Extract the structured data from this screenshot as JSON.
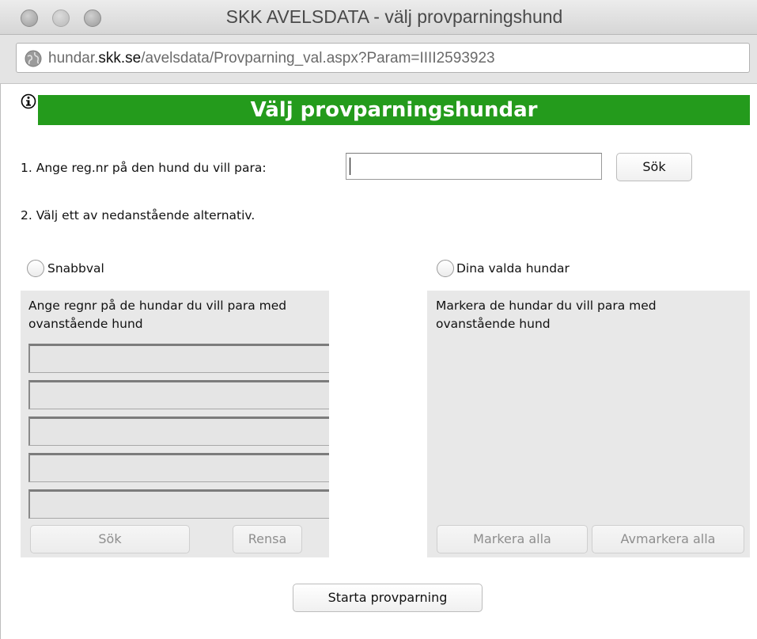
{
  "window": {
    "title": "SKK AVELSDATA - välj provparningshund"
  },
  "address": {
    "url_prefix": "hundar.",
    "url_domain": "skk.se",
    "url_path": "/avelsdata/Provparning_val.aspx?Param=IIII2593923"
  },
  "page": {
    "info_icon": "info-icon",
    "header": "Välj provparningshundar",
    "step1_label": "1. Ange reg.nr på den hund du vill para:",
    "reg_input_value": "",
    "search_button": "Sök",
    "step2_label": "2. Välj ett av nedanstående alternativ."
  },
  "quick": {
    "radio_label": "Snabbval",
    "selected": false,
    "instruction": "Ange regnr på de hundar du vill para med ovanstående hund",
    "inputs": [
      "",
      "",
      "",
      "",
      ""
    ],
    "search_button": "Sök",
    "clear_button": "Rensa"
  },
  "chosen": {
    "radio_label": "Dina valda hundar",
    "selected": false,
    "instruction": "Markera de hundar du vill para med ovanstående hund",
    "select_all_button": "Markera alla",
    "deselect_all_button": "Avmarkera alla"
  },
  "footer": {
    "start_button": "Starta provparning"
  },
  "colors": {
    "header_bg": "#249b1c",
    "panel_bg": "#e8e8e8"
  }
}
